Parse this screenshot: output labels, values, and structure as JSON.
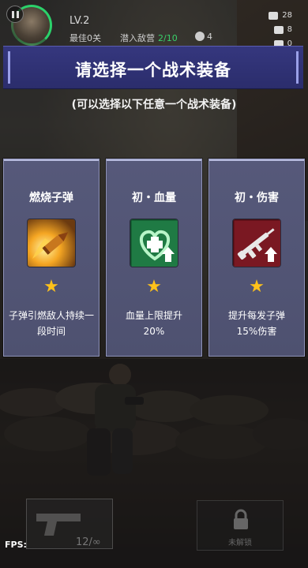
{
  "hud": {
    "level": "LV.2",
    "best_label": "最佳0关",
    "infiltrate_label": "潜入敌营",
    "infiltrate_value": "2/10",
    "enemy_count": "4",
    "right_stat_1": "28",
    "right_stat_2": "8",
    "right_stat_3": "0"
  },
  "title": "请选择一个战术装备",
  "subtitle": "(可以选择以下任意一个战术装备)",
  "cards": [
    {
      "title": "燃烧子弹",
      "icon": "incendiary-bullet-icon",
      "stars": "★",
      "desc_line1": "子弹引燃敌人持续一",
      "desc_line2": "段时间"
    },
    {
      "title": "初・血量",
      "icon": "health-heart-up-icon",
      "stars": "★",
      "desc_line1": "血量上限提升",
      "desc_line2": "20%"
    },
    {
      "title": "初・伤害",
      "icon": "rifle-damage-up-icon",
      "stars": "★",
      "desc_line1": "提升每发子弹",
      "desc_line2": "15%伤害"
    }
  ],
  "bottom": {
    "fps_label": "FPS:",
    "ammo": "12/∞",
    "locked_label": "未解锁"
  },
  "colors": {
    "banner": "#2f3174",
    "card": "#53567a",
    "star": "#ffc21a",
    "health_green": "#39d06a"
  }
}
